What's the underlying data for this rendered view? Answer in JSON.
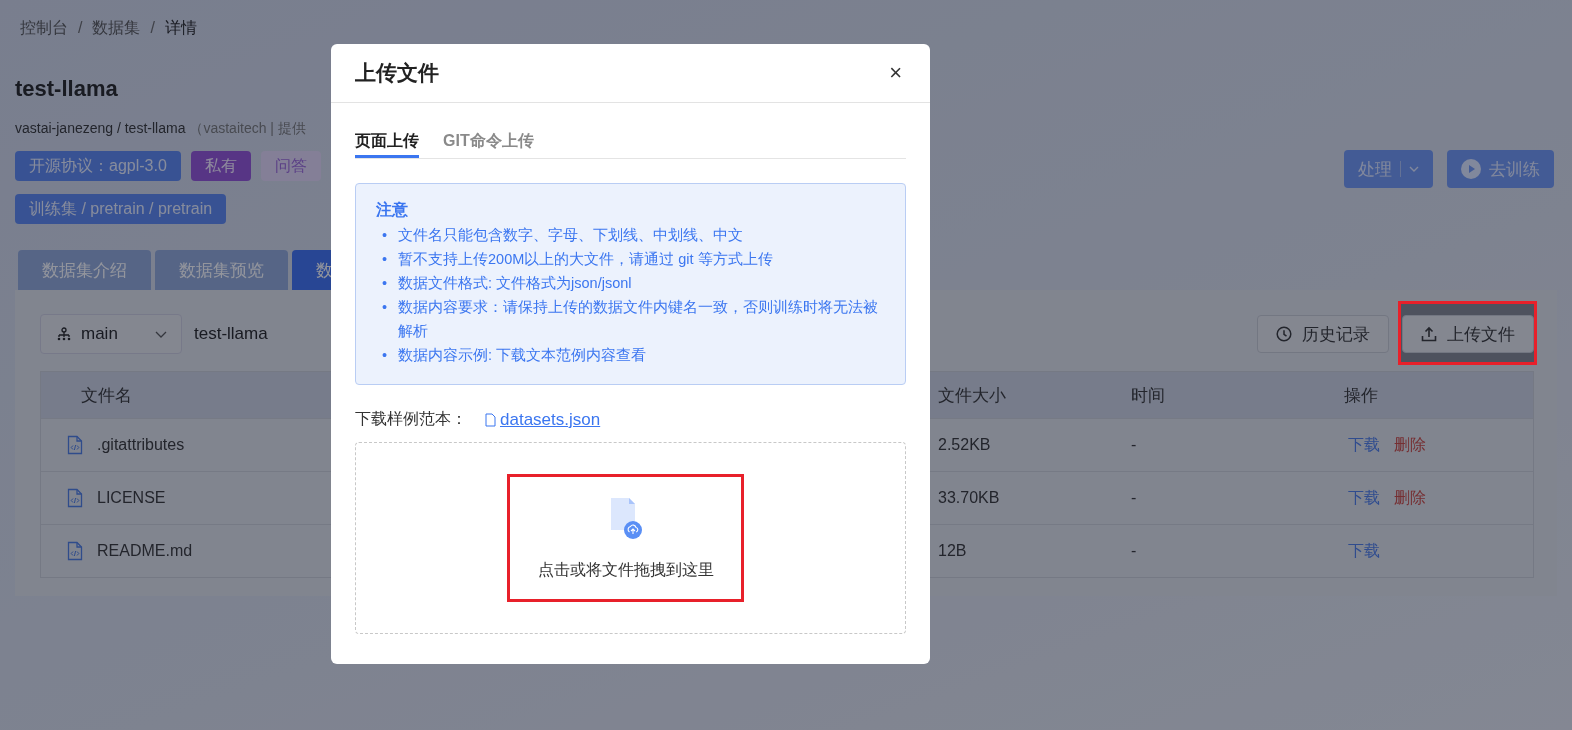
{
  "breadcrumb": {
    "items": [
      "控制台",
      "数据集",
      "详情"
    ],
    "separators": [
      "/",
      "/"
    ]
  },
  "dataset": {
    "title": "test-llama",
    "path": "vastai-janezeng / test-llama",
    "provider": "（vastaitech | 提供",
    "tags": [
      {
        "label": "开源协议：agpl-3.0",
        "kind": "license"
      },
      {
        "label": "私有",
        "kind": "visibility"
      },
      {
        "label": "问答",
        "kind": "task"
      }
    ],
    "category_tag": "训练集 / pretrain / pretrain"
  },
  "actions": [
    {
      "label": "处理",
      "kind": "dropdown"
    },
    {
      "label": "去训练",
      "kind": "play"
    }
  ],
  "tabs": [
    {
      "label": "数据集介绍",
      "selected": false
    },
    {
      "label": "数据集预览",
      "selected": false
    },
    {
      "label": "数",
      "selected": true
    }
  ],
  "files": {
    "branch": "main",
    "repo": "test-llama",
    "buttons": [
      {
        "label": "历史记录",
        "kind": "history",
        "highlighted": false
      },
      {
        "label": "上传文件",
        "kind": "upload",
        "highlighted": true
      }
    ],
    "columns": [
      "文件名",
      "文件大小",
      "时间",
      "操作"
    ],
    "rows": [
      {
        "name": ".gitattributes",
        "size": "2.52KB",
        "time": "-",
        "actions": [
          {
            "label": "下载",
            "kind": "download"
          },
          {
            "label": "删除",
            "kind": "delete"
          }
        ]
      },
      {
        "name": "LICENSE",
        "size": "33.70KB",
        "time": "-",
        "actions": [
          {
            "label": "下载",
            "kind": "download"
          },
          {
            "label": "删除",
            "kind": "delete"
          }
        ]
      },
      {
        "name": "README.md",
        "size": "12B",
        "time": "-",
        "actions": [
          {
            "label": "下载",
            "kind": "download"
          }
        ]
      }
    ]
  },
  "dialog": {
    "title": "上传文件",
    "close": "×",
    "tabs": [
      {
        "label": "页面上传",
        "selected": true
      },
      {
        "label": "GIT命令上传",
        "selected": false
      }
    ],
    "notice": {
      "title": "注意",
      "items": [
        {
          "bullet": "•",
          "text": "文件名只能包含数字、字母、下划线、中划线、中文"
        },
        {
          "bullet": "•",
          "text": "暂不支持上传200M以上的大文件，请通过 git 等方式上传"
        },
        {
          "bullet": "•",
          "text": "数据文件格式: 文件格式为json/jsonl"
        },
        {
          "bullet": "•",
          "text": "数据内容要求：请保持上传的数据文件内键名一致，否则训练时将无法被解析"
        },
        {
          "bullet": "•",
          "text": "数据内容示例: 下载文本范例内容查看"
        }
      ]
    },
    "sample": {
      "label": "下载样例范本：",
      "link": "datasets.json"
    },
    "dropzone": {
      "text": "点击或将文件拖拽到这里",
      "highlighted": true
    }
  }
}
